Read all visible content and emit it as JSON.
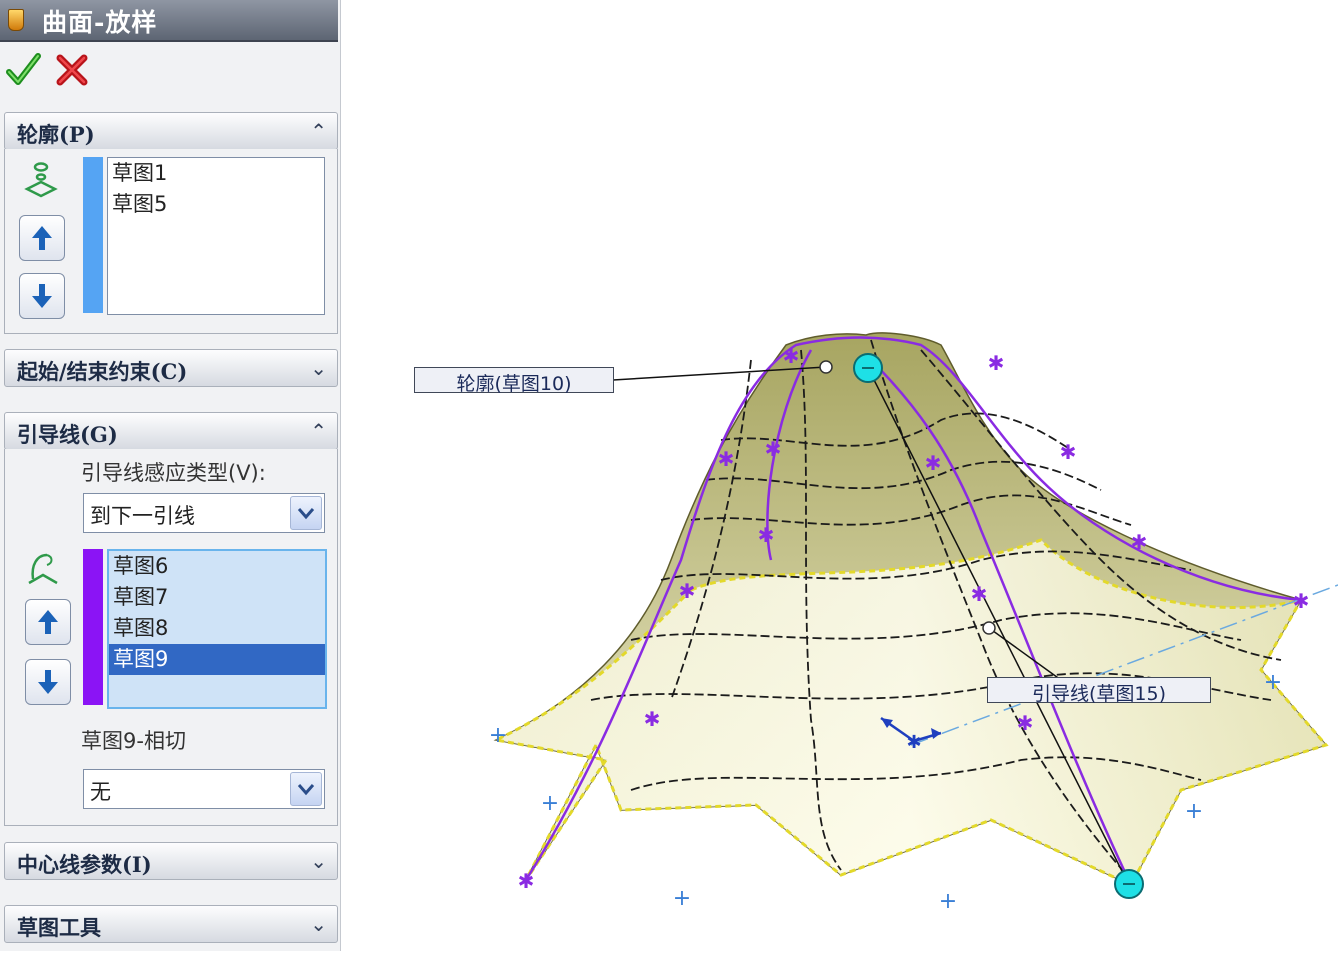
{
  "panel": {
    "title": "曲面-放样",
    "ok_icon": "check-icon",
    "cancel_icon": "x-icon",
    "colors": {
      "profile_bar": "#55a4f3",
      "guide_bar": "#8b14f5",
      "selected_row": "#3168c4",
      "selection_bg": "#cfe3f7"
    }
  },
  "profiles": {
    "header": "轮廓(P)",
    "expanded": true,
    "items": [
      "草图1",
      "草图5"
    ]
  },
  "start_end": {
    "header": "起始/结束约束(C)",
    "expanded": false
  },
  "guides": {
    "header": "引导线(G)",
    "expanded": true,
    "influence_label": "引导线感应类型(V):",
    "influence_value": "到下一引线",
    "items": [
      "草图6",
      "草图7",
      "草图8",
      "草图9"
    ],
    "selected_index": 3,
    "tangency_label": "草图9-相切",
    "tangency_value": "无"
  },
  "centerline": {
    "header": "中心线参数(I)",
    "expanded": false
  },
  "sketch_tools": {
    "header": "草图工具",
    "expanded": false
  },
  "viewport": {
    "callout_profile": "轮廓(草图10)",
    "callout_guide": "引导线(草图15)",
    "colors": {
      "surface": "#ecebc2",
      "guide_curve": "#8a2be2",
      "handle": "#1ee0e6"
    }
  }
}
